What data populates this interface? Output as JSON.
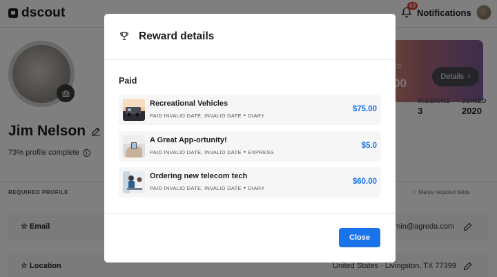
{
  "app": {
    "logo_text": "dscout"
  },
  "topbar": {
    "notifications_label": "Notifications",
    "notifications_count": "63"
  },
  "profile": {
    "name": "Jim Nelson",
    "complete_text": "73% profile complete",
    "rewards_label": "ED",
    "rewards_amount": "00",
    "details_label": "Details",
    "stats": [
      {
        "label": "MISSIONS",
        "value": "3"
      },
      {
        "label": "JOINED",
        "value": "2020"
      }
    ],
    "required_label": "REQUIRED PROFILE",
    "marks_label": "Marks required fields",
    "fields": [
      {
        "label": "Email",
        "value": "dmin@agreda.com"
      },
      {
        "label": "Location",
        "value": "United States · Livingston, TX 77399"
      }
    ]
  },
  "modal": {
    "title": "Reward details",
    "section_title": "Paid",
    "close_label": "Close",
    "rewards": [
      {
        "title": "Recreational Vehicles",
        "status": "PAID INVALID DATE, INVALID DATE",
        "type": "DIARY",
        "amount": "$75.00",
        "thumb_icon": "rv-photo"
      },
      {
        "title": "A Great App-ortunity!",
        "status": "PAID INVALID DATE, INVALID DATE",
        "type": "EXPRESS",
        "amount": "$5.0",
        "thumb_icon": "hands-photo"
      },
      {
        "title": "Ordering new telecom tech",
        "status": "PAID INVALID DATE, INVALID DATE",
        "type": "DIARY",
        "amount": "$60.00",
        "thumb_icon": "office-photo"
      }
    ]
  },
  "colors": {
    "accent": "#1a73e8",
    "badge": "#e53935"
  }
}
